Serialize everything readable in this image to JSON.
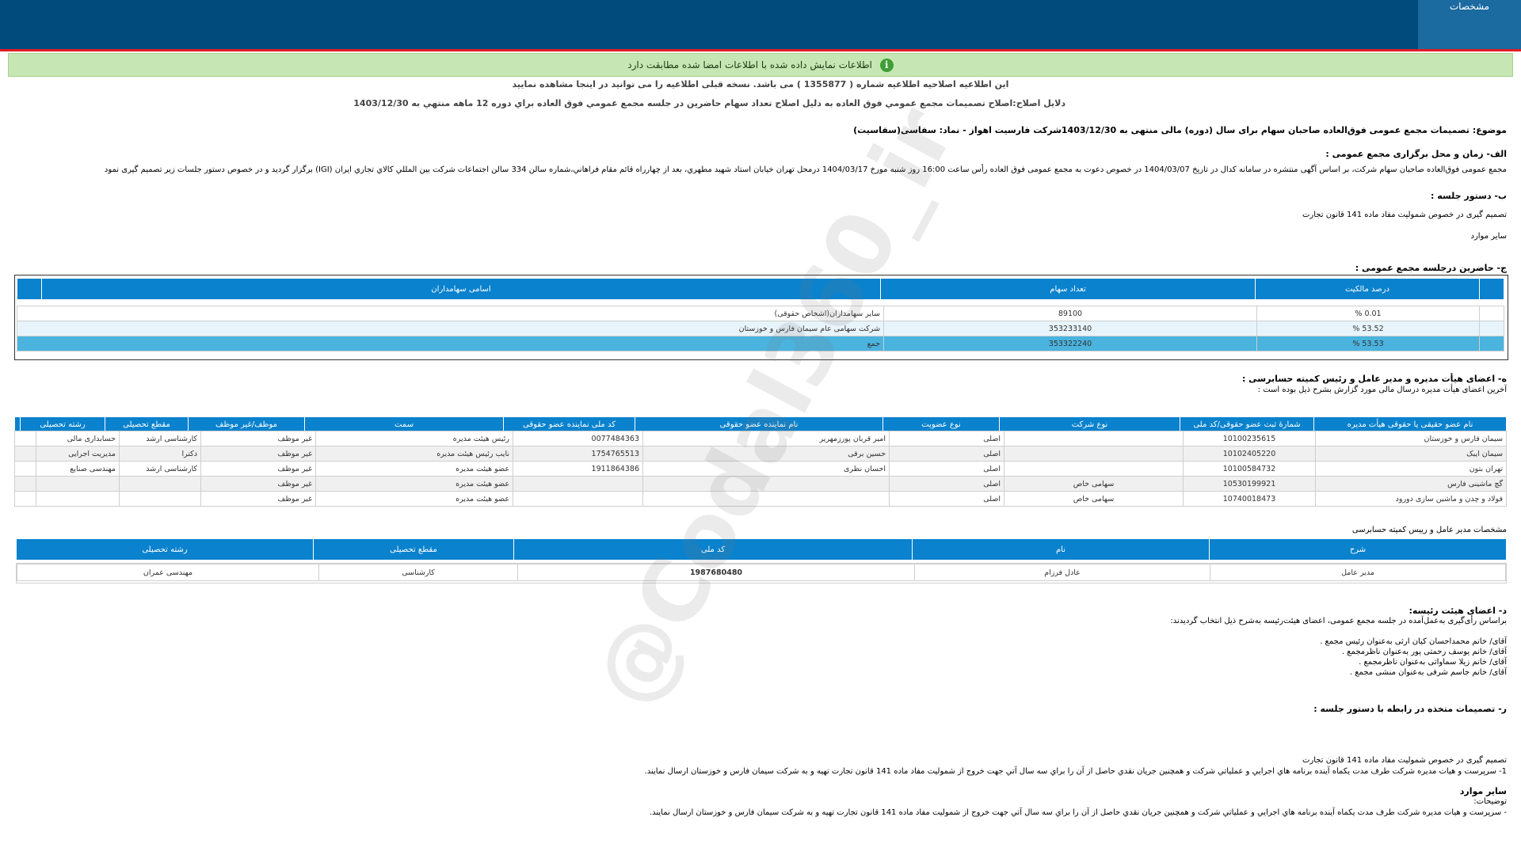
{
  "header": {
    "tab_label": "مشخصات"
  },
  "notice": {
    "icon": "i",
    "text": "اطلاعات نمایش داده شده با اطلاعات امضا شده مطابقت دارد"
  },
  "correction": {
    "line1": "این اطلاعیه اصلاحیه اطلاعیه شماره ( 1355877 ) می باشد. نسخه قبلی اطلاعیه را می توانید در اینجا مشاهده نمایید",
    "line2": "دلایل اصلاح:اصلاح تصمیمات مجمع عمومي فوق العاده به دليل اصلاح تعداد سهام حاضرين در جلسه مجمع عمومي فوق العاده براي دوره 12 ماهه منتهي به 1403/12/30"
  },
  "subject": "موضوع: تصمیمات مجمع عمومی فوق‌العاده صاحبان سهام برای سال (دوره) مالی منتهی به 1403/12/30شرکت فارسیت اهواز - نماد: سفاسی(سفاسیت)",
  "section_a": {
    "title": "الف- زمان و محل برگزاری مجمع عمومی :",
    "text": "مجمع عمومی فوق‌العاده صاحبان سهام شرکت، بر اساس آگهی منتشره در سامانه کدال در تاریخ 1404/03/07 در خصوص دعوت به مجمع عمومی فوق العاده رأس ساعت 16:00 روز شنبه مورخ 1404/03/17 درمحل تهران خيابان استاد شهيد مطهري، بعد از چهارراه قائم مقام فراهاني،شماره سالن 334 سالن اجتماعات شرکت بين المللي کالاي تجاري ايران (IGI)   برگزار گردید و در خصوص دستور جلسات زیر تصمیم گیری نمود"
  },
  "section_b": {
    "title": "ب- دستور جلسه :",
    "items": [
      "تصمیم گیری در خصوص شمولیت مفاد ماده 141 قانون تجارت",
      "سایر موارد"
    ]
  },
  "section_c": {
    "title": "ج- حاضرین درجلسه مجمع عمومی :",
    "headers": [
      "اسامی سهامداران",
      "تعداد سهام",
      "درصد مالکیت"
    ],
    "rows": [
      [
        "سایر سهامداران(اشخاص حقوقی)",
        "89100",
        "0.01 %"
      ],
      [
        "شرکت سهامی عام سیمان فارس و خوزستان",
        "353233140",
        "53.52 %"
      ],
      [
        "جمع",
        "353322240",
        "53.53 %"
      ]
    ]
  },
  "section_d": {
    "title": "ه- اعضای هیأت مدیره و مدیر عامل و رئیس کمیته حسابرسی :",
    "subtitle": "آخرین اعضای هیأت مدیره درسال مالی مورد گزارش بشرح ذیل بوده است :",
    "headers": [
      "نام عضو حقیقی یا حقوقی هیأت مدیره",
      "شمارهٔ ثبت عضو حقوقی/کد ملی",
      "نوع شرکت",
      "نوع عضویت",
      "نام نماینده عضو حقوقی",
      "کد ملی نماینده عضو حقوقی",
      "سمت",
      "موظف/غیر موظف",
      "مقطع تحصیلی",
      "رشته تحصیلی"
    ],
    "rows": [
      [
        "سیمان فارس و خوزستان",
        "10100235615",
        "",
        "اصلی",
        "امیر قربان پورزمهریر",
        "0077484363",
        "رئیس هیئت مدیره",
        "غیر موظف",
        "کارشناسی ارشد",
        "حسابداری مالی"
      ],
      [
        "سیمان ایبک",
        "10102405220",
        "",
        "اصلی",
        "حسین برقی",
        "1754765513",
        "نایب رئیس هیئت مدیره",
        "غیر موظف",
        "دکترا",
        "مدیریت اجرایی"
      ],
      [
        "تهران بتون",
        "10100584732",
        "",
        "اصلی",
        "احسان نظری",
        "1911864386",
        "عضو هیئت مدیره",
        "غیر موظف",
        "کارشناسی ارشد",
        "مهندسی صنایع"
      ],
      [
        "گچ ماشینی فارس",
        "10530199921",
        "سهامی خاص",
        "اصلی",
        "",
        "",
        "عضو هیئت مدیره",
        "غیر موظف",
        "",
        ""
      ],
      [
        "فولاد و چدن و ماشین سازی دورود",
        "10740018473",
        "سهامی خاص",
        "اصلی",
        "",
        "",
        "عضو هیئت مدیره",
        "غیر موظف",
        "",
        ""
      ]
    ]
  },
  "ceo": {
    "title": "مشخصات مدیر عامل و رییس کمیته حسابرسی",
    "headers": [
      "شرح",
      "نام",
      "کد ملی",
      "مقطع تحصیلی",
      "رشته تحصیلی"
    ],
    "row": [
      "مدیر عامل",
      "عادل فرزام",
      "1987680480",
      "کارشناسی",
      "مهندسی عمران"
    ]
  },
  "section_e": {
    "title": "د- اعضای هیئت رئیسه:",
    "intro": "براساس رأی‌گیری به‌عمل‌آمده در جلسه مجمع عمومی، اعضای هیئت‌رئیسه به‌شرح ذیل انتخاب گردیدند:",
    "items": [
      "آقای/ خانم   محمداحسان کیان ارثی   به‌عنوان رئیس مجمع .",
      "آقای/ خانم   یوسف رحمتی پور   به‌عنوان ناظرمجمع .",
      "آقای/ خانم   زیلا سماواتی   به‌عنوان ناظرمجمع .",
      "آقای/ خانم   جاسم شرفی   به‌عنوان منشی مجمع ."
    ]
  },
  "section_f": {
    "title": "ر- تصمیمات متخذه در رابطه با دستور جلسه :",
    "line1": "تصمیم گیری در خصوص شمولیت مفاد ماده 141 قانون تجارت",
    "line2": "1- سرپرست و هيات مديره شرکت طرف مدت يکماه آينده برنامه هاي اجرايي و عملياتي شرکت و همچنين جريان نقدي حاصل از آن را براي سه سال آتي جهت خروج از شموليت مفاد ماده 141 قانون تجارت تهيه و به شرکت سيمان فارس و خوزستان ارسال نمايند.",
    "other_title": "سایر موارد",
    "notes_label": "توضیحات:",
    "line3": "- سرپرست و هيات مديره شرکت طرف مدت يکماه آينده برنامه هاي اجرايي و عملياتي شرکت و همچنين جريان نقدي حاصل از آن را براي سه سال آتي جهت خروج از شموليت مفاد ماده 141 قانون تجارت تهيه و به شرکت سيمان فارس و خوزستان ارسال نمايند."
  },
  "watermark": "@Codal360_ir"
}
